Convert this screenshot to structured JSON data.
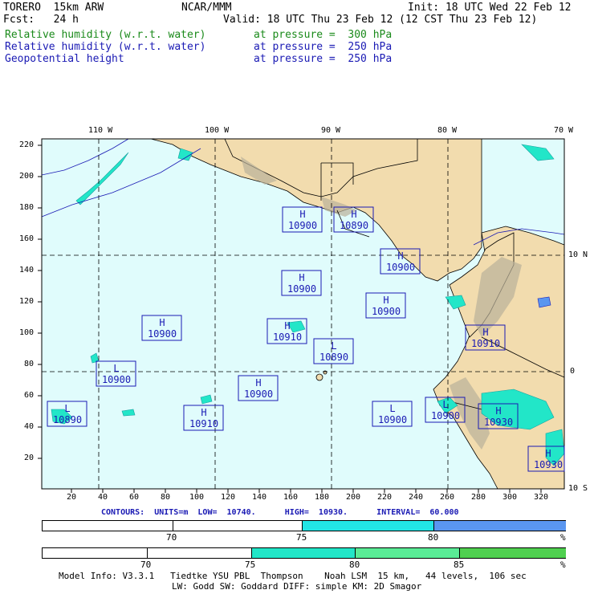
{
  "header": {
    "model": "TORERO  15km ARW",
    "org": "NCAR/MMM",
    "init": "Init: 18 UTC Wed 22 Feb 12",
    "fcst": "Fcst:   24 h",
    "valid": "Valid: 18 UTC Thu 23 Feb 12 (12 CST Thu 23 Feb 12)",
    "fields": [
      {
        "name": "Relative humidity (w.r.t. water)",
        "level": "at pressure =  300 hPa",
        "color": "#1a8a1a"
      },
      {
        "name": "Relative humidity (w.r.t. water)",
        "level": "at pressure =  250 hPa",
        "color": "#1a1ab4"
      },
      {
        "name": "Geopotential height",
        "level": "at pressure =  250 hPa",
        "color": "#1a1ab4"
      }
    ]
  },
  "map": {
    "lon_labels": [
      "110 W",
      "100 W",
      "90 W",
      "80 W",
      "70 W"
    ],
    "lat_labels": [
      "10 N",
      "0",
      "10 S"
    ],
    "y_ticks": [
      "220",
      "200",
      "180",
      "160",
      "140",
      "120",
      "100",
      "80",
      "60",
      "40",
      "20"
    ],
    "x_ticks": [
      "20",
      "40",
      "60",
      "80",
      "100",
      "120",
      "140",
      "160",
      "180",
      "200",
      "220",
      "240",
      "260",
      "280",
      "300",
      "320"
    ],
    "ocean_color": "#e0fcfc",
    "land_color": "#f2dcae",
    "centers": [
      {
        "type": "H",
        "value": "10900"
      },
      {
        "type": "H",
        "value": "10890"
      },
      {
        "type": "H",
        "value": "10900"
      },
      {
        "type": "H",
        "value": "10900"
      },
      {
        "type": "H",
        "value": "10900"
      },
      {
        "type": "H",
        "value": "10900"
      },
      {
        "type": "H",
        "value": "10910"
      },
      {
        "type": "L",
        "value": "10890"
      },
      {
        "type": "H",
        "value": "10910"
      },
      {
        "type": "L",
        "value": "10900"
      },
      {
        "type": "H",
        "value": "10900"
      },
      {
        "type": "L",
        "value": "10890"
      },
      {
        "type": "H",
        "value": "10910"
      },
      {
        "type": "L",
        "value": "10900"
      },
      {
        "type": "L",
        "value": "10900"
      },
      {
        "type": "H",
        "value": "10930"
      },
      {
        "type": "H",
        "value": "10930"
      }
    ]
  },
  "contours": "CONTOURS:  UNITS=m  LOW=  10740.      HIGH=  10930.      INTERVAL=  60.000",
  "colorbar1": {
    "ticks": [
      "70",
      "75",
      "80",
      "%"
    ],
    "colors": [
      "#ffffff",
      "#ffffff",
      "#22e6e6",
      "#5a96f0"
    ]
  },
  "colorbar2": {
    "ticks": [
      "70",
      "75",
      "80",
      "85",
      "%"
    ],
    "colors": [
      "#ffffff",
      "#ffffff",
      "#22e6c8",
      "#5aec96",
      "#50d050"
    ]
  },
  "footer": {
    "line1": "Model Info: V3.3.1   Tiedtke YSU PBL  Thompson    Noah LSM  15 km,   44 levels,  106 sec",
    "line2": "LW: Godd SW: Goddard DIFF: simple KM: 2D Smagor"
  }
}
